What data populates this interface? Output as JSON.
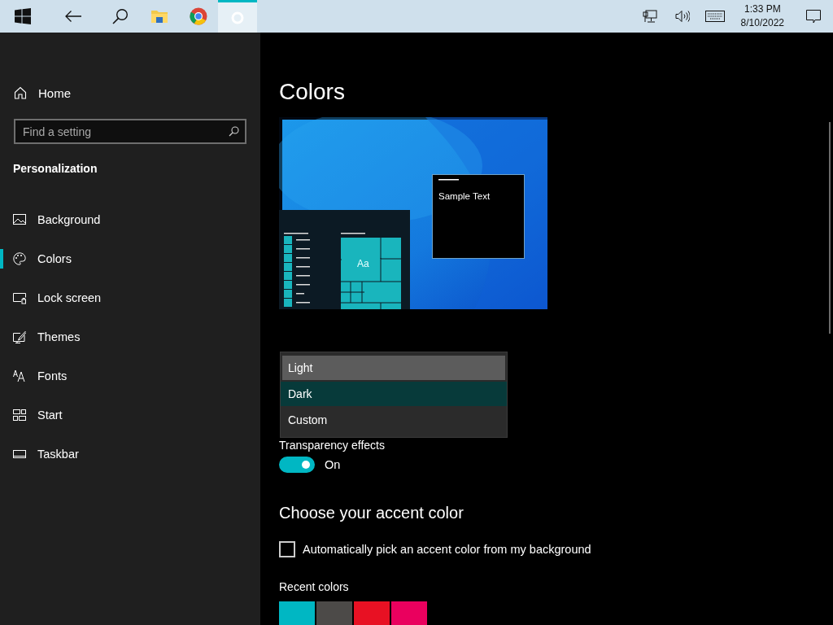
{
  "taskbar": {
    "buttons": [
      {
        "kind": "start",
        "selected": false
      },
      {
        "kind": "back",
        "selected": false
      },
      {
        "kind": "search",
        "selected": false
      },
      {
        "kind": "folder",
        "selected": false
      },
      {
        "kind": "browser",
        "selected": false
      },
      {
        "kind": "settings",
        "selected": true
      }
    ],
    "tray": [
      {
        "kind": "network"
      },
      {
        "kind": "volume"
      },
      {
        "kind": "keyboard"
      }
    ],
    "time": "1:33 PM",
    "date": "8/10/2022"
  },
  "sidebar": {
    "home": "Home",
    "search": {
      "placeholder": "Find a setting"
    },
    "section": "Personalization",
    "items": [
      {
        "kind": "image",
        "label": "Background",
        "selected": false
      },
      {
        "kind": "palette",
        "label": "Colors",
        "selected": true
      },
      {
        "kind": "lock",
        "label": "Lock screen",
        "selected": false
      },
      {
        "kind": "themes",
        "label": "Themes",
        "selected": false
      },
      {
        "kind": "fonts",
        "label": "Fonts",
        "selected": false
      },
      {
        "kind": "start",
        "label": "Start",
        "selected": false
      },
      {
        "kind": "taskbar",
        "label": "Taskbar",
        "selected": false
      }
    ]
  },
  "main": {
    "title": "Colors",
    "preview": {
      "sample_text": "Sample Text",
      "tile_label": "Aa"
    },
    "dropdown": {
      "options": [
        {
          "label": "Light",
          "selected": false,
          "hovered": true
        },
        {
          "label": "Dark",
          "selected": true,
          "hovered": false
        },
        {
          "label": "Custom",
          "selected": false,
          "hovered": false
        }
      ]
    },
    "transparency": {
      "label": "Transparency effects",
      "on": true,
      "state_text": "On"
    },
    "accent": {
      "heading": "Choose your accent color",
      "auto_pick": {
        "label": "Automatically pick an accent color from my background",
        "checked": false
      },
      "recent_label": "Recent colors",
      "recent_colors": [
        {
          "color": "#00b7c3"
        },
        {
          "color": "#4c4a48"
        },
        {
          "color": "#e81123"
        },
        {
          "color": "#ea005e"
        }
      ]
    }
  }
}
